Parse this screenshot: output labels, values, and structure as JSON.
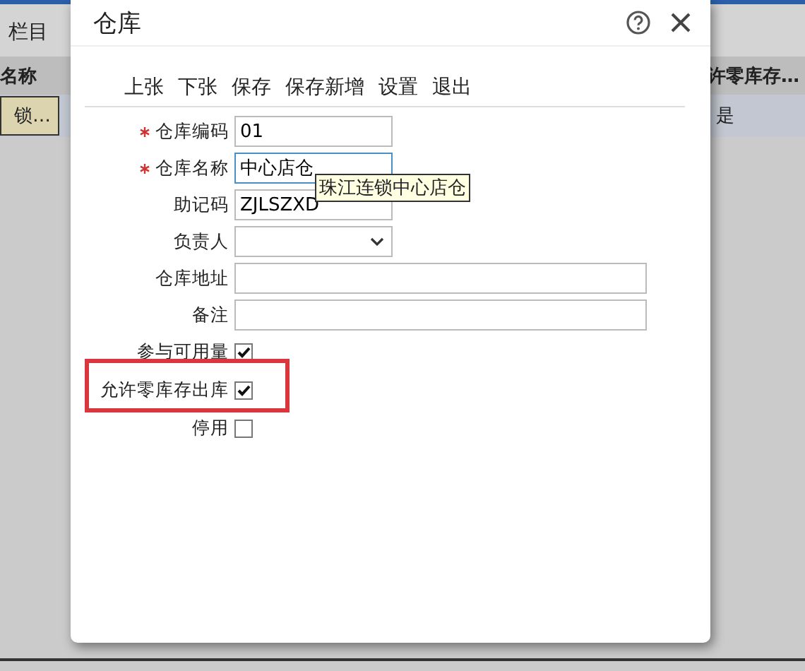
{
  "background": {
    "tab": "栏目",
    "columns": [
      "名称",
      "许零库存…"
    ],
    "row": [
      {
        "text": "锁…",
        "selected": true
      },
      {
        "text": "是",
        "selected": false
      }
    ]
  },
  "dialog": {
    "title": "仓库",
    "toolbar": [
      "上张",
      "下张",
      "保存",
      "保存新增",
      "设置",
      "退出"
    ],
    "fields": [
      {
        "label": "仓库编码",
        "required": true,
        "kind": "text",
        "value": "01",
        "focused": false
      },
      {
        "label": "仓库名称",
        "required": true,
        "kind": "text",
        "value": "中心店仓",
        "focused": true
      },
      {
        "label": "助记码",
        "required": false,
        "kind": "text",
        "value": "ZJLSZXD",
        "focused": false
      },
      {
        "label": "负责人",
        "required": false,
        "kind": "select"
      },
      {
        "label": "仓库地址",
        "required": false,
        "kind": "long_text"
      },
      {
        "label": "备注",
        "required": false,
        "kind": "long_text"
      },
      {
        "label": "参与可用量",
        "required": false,
        "kind": "checkbox",
        "checked": true,
        "highlighted": false
      },
      {
        "label": "允许零库存出库",
        "required": false,
        "kind": "checkbox",
        "checked": true,
        "highlighted": true
      },
      {
        "label": "停用",
        "required": false,
        "kind": "checkbox",
        "checked": false,
        "highlighted": false
      }
    ],
    "tooltip": "珠江连锁中心店仓"
  }
}
